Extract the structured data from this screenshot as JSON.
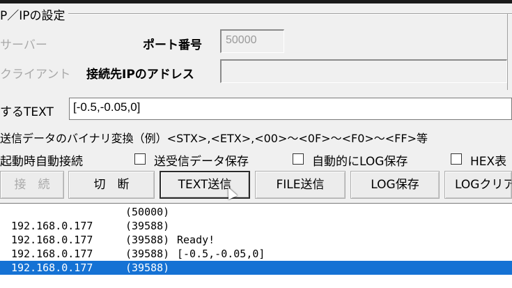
{
  "groupbox": {
    "title": "P／IPの設定"
  },
  "server": {
    "label": "サーバー"
  },
  "port": {
    "label": "ポート番号",
    "value": "50000"
  },
  "client": {
    "label": "クライアント"
  },
  "dest_ip": {
    "label": "接続先IPのアドレス",
    "value": ""
  },
  "send_text": {
    "label": "するTEXT",
    "value": "[-0.5,-0.05,0]"
  },
  "binary_note": "送信データのバイナリ変換（例）<STX>,<ETX>,<00>～<0F>～<F0>～<FF>等",
  "options": {
    "auto_connect_label": "起動時自動接続",
    "save_data_label": "送受信データ保存",
    "auto_log_label": "自動的にLOG保存",
    "hex_label": "HEX表"
  },
  "buttons": {
    "connect": "接　続",
    "disconnect": "切　断",
    "text_send": "TEXT送信",
    "file_send": "FILE送信",
    "log_save": "LOG保存",
    "log_clear": "LOGクリア"
  },
  "log": [
    {
      "ip": "",
      "port": "(50000)",
      "msg": ""
    },
    {
      "ip": "192.168.0.177",
      "port": "(39588)",
      "msg": ""
    },
    {
      "ip": "192.168.0.177",
      "port": "(39588)",
      "msg": "Ready!"
    },
    {
      "ip": "192.168.0.177",
      "port": "(39588)",
      "msg": "[-0.5,-0.05,0]"
    },
    {
      "ip": "192.168.0.177",
      "port": "(39588)",
      "msg": ""
    }
  ]
}
